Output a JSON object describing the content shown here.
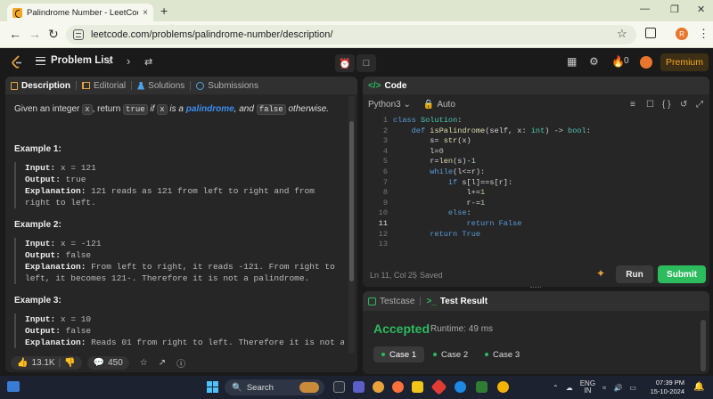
{
  "browser": {
    "tab_title": "Palindrome Number - LeetCode",
    "tab_close": "×",
    "new_tab": "+",
    "url": "leetcode.com/problems/palindrome-number/description/",
    "profile_initial": "R"
  },
  "lc_nav": {
    "problem_list": "Problem List",
    "streak_count": "0",
    "premium": "Premium"
  },
  "left_panel": {
    "tabs": [
      "Description",
      "Editorial",
      "Solutions",
      "Submissions"
    ],
    "statement": {
      "p1": "Given an integer ",
      "x": "x",
      "p2": ", return ",
      "true": "true",
      "p3": " if ",
      "x2": "x",
      "p4": " is a ",
      "palindrome": "palindrome",
      "p5": ", and ",
      "false": "false",
      "p6": " otherwise."
    },
    "examples": [
      {
        "heading": "Example 1:",
        "input_label": "Input:",
        "input": " x = 121",
        "output_label": "Output:",
        "output": " true",
        "expl_label": "Explanation:",
        "expl": " 121 reads as 121 from left to right and from right to left."
      },
      {
        "heading": "Example 2:",
        "input_label": "Input:",
        "input": " x = -121",
        "output_label": "Output:",
        "output": " false",
        "expl_label": "Explanation:",
        "expl": " From left to right, it reads -121. From right to left, it becomes 121-. Therefore it is not a palindrome."
      },
      {
        "heading": "Example 3:",
        "input_label": "Input:",
        "input": " x = 10",
        "output_label": "Output:",
        "output": " false",
        "expl_label": "Explanation:",
        "expl": " Reads 01 from right to left. Therefore it is not a"
      }
    ],
    "footer": {
      "likes": "13.1K",
      "comments": "450"
    }
  },
  "code_panel": {
    "title": "Code",
    "language": "Python3",
    "auto": "Auto",
    "line_numbers": [
      "1",
      "2",
      "3",
      "4",
      "5",
      "6",
      "7",
      "8",
      "9",
      "10",
      "11",
      "12",
      "13"
    ],
    "status_position": "Ln 11, Col 25",
    "status_saved": "Saved",
    "run": "Run",
    "submit": "Submit"
  },
  "test_panel": {
    "tab_testcase": "Testcase",
    "tab_result": "Test Result",
    "status": "Accepted",
    "runtime": "Runtime: 49 ms",
    "cases": [
      "Case 1",
      "Case 2",
      "Case 3"
    ]
  },
  "taskbar": {
    "search": "Search",
    "lang_top": "ENG",
    "lang_bottom": "IN",
    "time": "07:39 PM",
    "date": "15-10-2024"
  },
  "colors": {
    "accent_green": "#2cbb5d",
    "premium_gold": "#f5a623",
    "link_blue": "#3b8ef0"
  }
}
